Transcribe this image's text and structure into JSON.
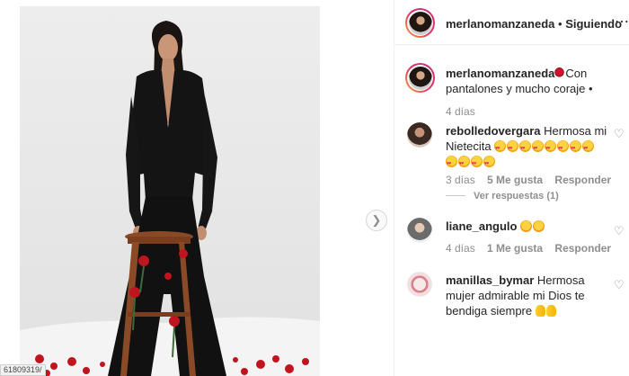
{
  "post": {
    "username": "merlanomanzaneda",
    "follow_status": "Siguiendo",
    "separator": "•",
    "caption": "Con pantalones y mucho coraje •",
    "caption_time": "4 días",
    "url_fragment": "61809319/"
  },
  "comments": [
    {
      "username": "rebolledovergara",
      "text": "Hermosa mi Nietecita",
      "time": "3 días",
      "likes": "5 Me gusta",
      "reply_label": "Responder",
      "view_replies": "Ver respuestas (1)"
    },
    {
      "username": "liane_angulo",
      "text": "",
      "time": "4 días",
      "likes": "1 Me gusta",
      "reply_label": "Responder"
    },
    {
      "username": "manillas_bymar",
      "text": "Hermosa mujer admirable mi Dios te bendiga siempre"
    }
  ],
  "icons": {
    "more": "more-options-icon",
    "like": "heart-outline-icon",
    "next": "chevron-right-icon"
  },
  "colors": {
    "text": "#262626",
    "meta": "#8e8e8e",
    "border": "#efefef"
  }
}
